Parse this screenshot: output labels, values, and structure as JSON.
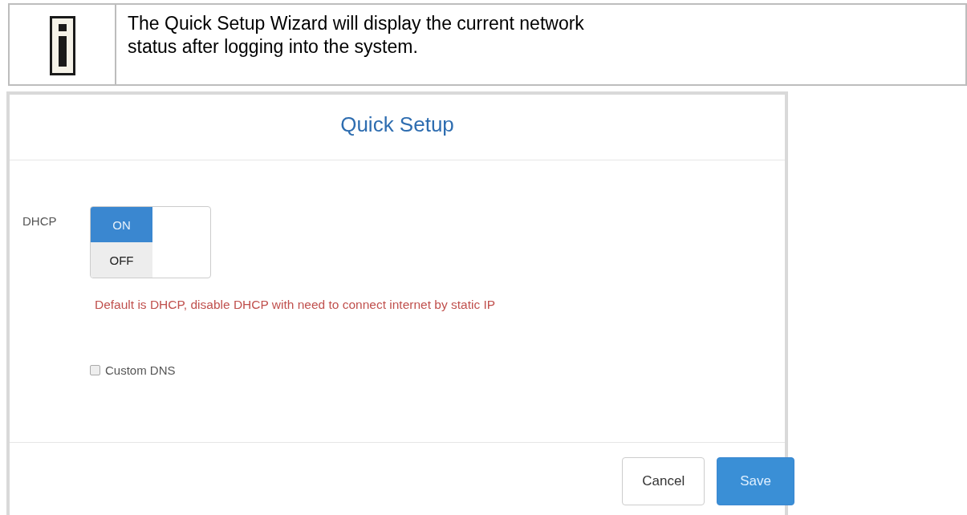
{
  "note": {
    "text": "The Quick Setup Wizard will display the current network status after logging into the system."
  },
  "dialog": {
    "title": "Quick Setup",
    "dhcp": {
      "label": "DHCP",
      "options": [
        {
          "label": "ON",
          "selected": true
        },
        {
          "label": "OFF",
          "selected": false
        }
      ]
    },
    "hint": "Default is DHCP, disable DHCP with need to connect internet by static IP",
    "custom_dns": {
      "label": "Custom DNS",
      "checked": false
    },
    "buttons": [
      {
        "label": "Cancel",
        "kind": "secondary"
      },
      {
        "label": "Save",
        "kind": "primary"
      }
    ]
  }
}
